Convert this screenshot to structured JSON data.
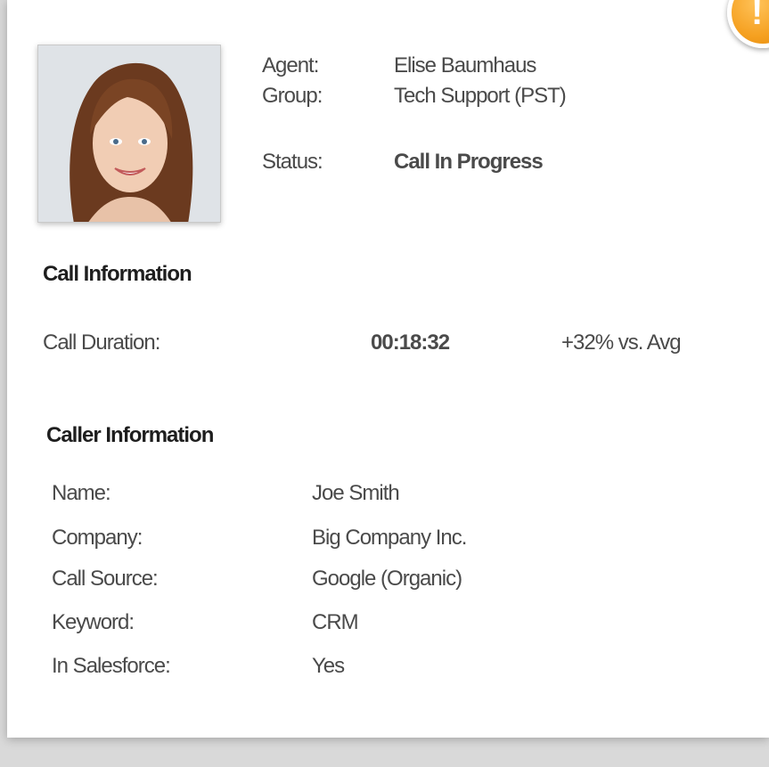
{
  "agent": {
    "agent_label": "Agent:",
    "agent_value": "Elise Baumhaus",
    "group_label": "Group:",
    "group_value": "Tech Support (PST)",
    "status_label": "Status:",
    "status_value": "Call In Progress"
  },
  "alert": {
    "symbol": "!"
  },
  "call_info": {
    "title": "Call Information",
    "duration_label": "Call Duration:",
    "duration_value": "00:18:32",
    "comparison": "+32% vs. Avg"
  },
  "caller_info": {
    "title": "Caller Information",
    "rows": [
      {
        "label": "Name:",
        "value": "Joe Smith"
      },
      {
        "label": "Company:",
        "value": "Big Company Inc."
      },
      {
        "label": "Call Source:",
        "value": "Google (Organic)"
      },
      {
        "label": "Keyword:",
        "value": "CRM"
      },
      {
        "label": "In Salesforce:",
        "value": "Yes"
      }
    ]
  },
  "colors": {
    "status_red": "#ff0000",
    "alert_orange": "#f5a020"
  }
}
